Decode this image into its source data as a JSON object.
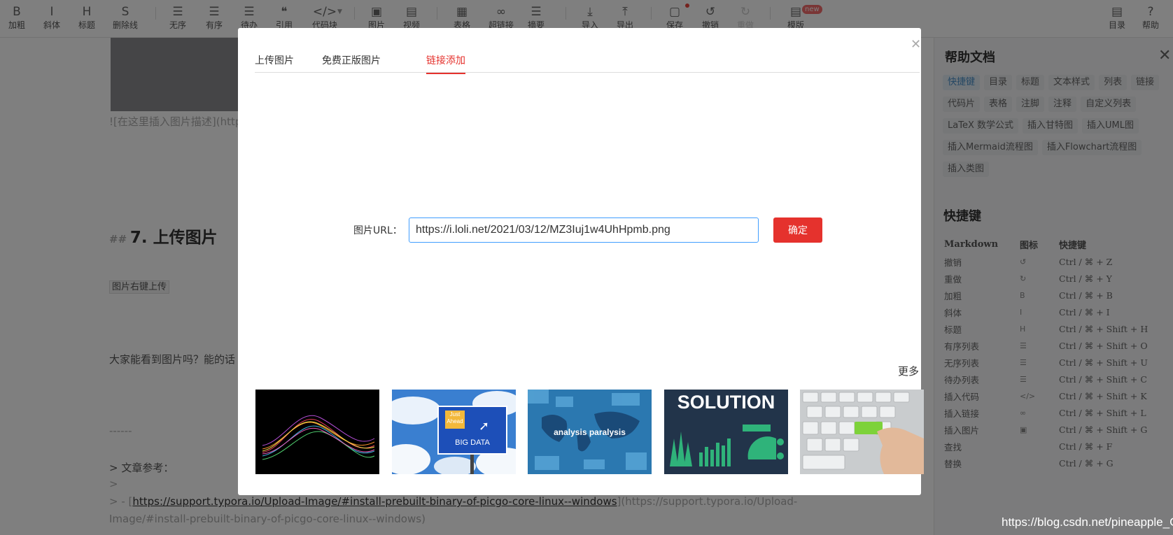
{
  "toolbar": {
    "items": [
      {
        "label": "加粗",
        "icon": "bold-icon",
        "glyph": "B"
      },
      {
        "label": "斜体",
        "icon": "italic-icon",
        "glyph": "I"
      },
      {
        "label": "标题",
        "icon": "heading-icon",
        "glyph": "H"
      },
      {
        "label": "删除线",
        "icon": "strikethrough-icon",
        "glyph": "S"
      },
      {
        "label": "无序",
        "icon": "unordered-list-icon",
        "glyph": "☰"
      },
      {
        "label": "有序",
        "icon": "ordered-list-icon",
        "glyph": "☰"
      },
      {
        "label": "待办",
        "icon": "todo-list-icon",
        "glyph": "☰"
      },
      {
        "label": "引用",
        "icon": "quote-icon",
        "glyph": "❝"
      },
      {
        "label": "代码块",
        "icon": "code-block-icon",
        "glyph": "</>"
      },
      {
        "label": "图片",
        "icon": "image-icon",
        "glyph": "▣"
      },
      {
        "label": "视频",
        "icon": "video-icon",
        "glyph": "▤"
      },
      {
        "label": "表格",
        "icon": "table-icon",
        "glyph": "▦"
      },
      {
        "label": "超链接",
        "icon": "link-icon",
        "glyph": "∞"
      },
      {
        "label": "摘要",
        "icon": "abstract-icon",
        "glyph": "☰"
      },
      {
        "label": "导入",
        "icon": "import-icon",
        "glyph": "⤓"
      },
      {
        "label": "导出",
        "icon": "export-icon",
        "glyph": "⤒"
      },
      {
        "label": "保存",
        "icon": "save-icon",
        "glyph": "▢"
      },
      {
        "label": "撤销",
        "icon": "undo-icon",
        "glyph": "↺"
      },
      {
        "label": "重做",
        "icon": "redo-icon",
        "glyph": "↻"
      },
      {
        "label": "模版",
        "icon": "template-icon",
        "glyph": "▤"
      },
      {
        "label": "目录",
        "icon": "toc-icon",
        "glyph": "▤"
      },
      {
        "label": "帮助",
        "icon": "help-icon",
        "glyph": "?"
      }
    ],
    "new_badge": "new"
  },
  "editor": {
    "img_markdown": "![在这里插入图片描述](http",
    "heading_hash": "##",
    "heading_text": "7. 上传图片",
    "inline_code": "图片右键上传",
    "para": "大家能看到图片吗？能的话",
    "hr": "------",
    "quote1": "> 文章参考：",
    "quote2": ">",
    "quote3_prefix": "> - [",
    "quote3_link": "https://support.typora.io/Upload-Image/#install-prebuilt-binary-of-picgo-core-linux--windows",
    "quote3_suffix": "](https://support.typora.io/Upload-",
    "quote4": "Image/#install-prebuilt-binary-of-picgo-core-linux--windows)"
  },
  "help": {
    "title": "帮助文档",
    "tags": [
      "快捷键",
      "目录",
      "标题",
      "文本样式",
      "列表",
      "链接",
      "代码片",
      "表格",
      "注脚",
      "注释",
      "自定义列表",
      "LaTeX 数学公式",
      "插入甘特图",
      "插入UML图",
      "插入Mermaid流程图",
      "插入Flowchart流程图",
      "插入类图"
    ],
    "shortcut_title": "快捷键",
    "columns": [
      "Markdown",
      "图标",
      "快捷键"
    ],
    "rows": [
      {
        "name": "撤销",
        "icon": "↺",
        "keys": "Ctrl / ⌘ + Z"
      },
      {
        "name": "重做",
        "icon": "↻",
        "keys": "Ctrl / ⌘ + Y"
      },
      {
        "name": "加粗",
        "icon": "B",
        "keys": "Ctrl / ⌘ + B"
      },
      {
        "name": "斜体",
        "icon": "I",
        "keys": "Ctrl / ⌘ + I"
      },
      {
        "name": "标题",
        "icon": "H",
        "keys": "Ctrl / ⌘ + Shift + H"
      },
      {
        "name": "有序列表",
        "icon": "☰",
        "keys": "Ctrl / ⌘ + Shift + O"
      },
      {
        "name": "无序列表",
        "icon": "☰",
        "keys": "Ctrl / ⌘ + Shift + U"
      },
      {
        "name": "待办列表",
        "icon": "☰",
        "keys": "Ctrl / ⌘ + Shift + C"
      },
      {
        "name": "插入代码",
        "icon": "</>",
        "keys": "Ctrl / ⌘ + Shift + K"
      },
      {
        "name": "插入链接",
        "icon": "∞",
        "keys": "Ctrl / ⌘ + Shift + L"
      },
      {
        "name": "插入图片",
        "icon": "▣",
        "keys": "Ctrl / ⌘ + Shift + G"
      },
      {
        "name": "查找",
        "icon": "",
        "keys": "Ctrl / ⌘ + F"
      },
      {
        "name": "替换",
        "icon": "",
        "keys": "Ctrl / ⌘ + G"
      }
    ]
  },
  "modal": {
    "tabs": [
      "上传图片",
      "免费正版图片",
      "链接添加"
    ],
    "active_tab": 2,
    "url_label": "图片URL：",
    "url_value": "https://i.loli.net/2021/03/12/MZ3Iuj1w4UhHpmb.png",
    "confirm": "确定",
    "more": "更多",
    "thumbs": [
      {
        "icon": "abstract-wave-image"
      },
      {
        "icon": "big-data-sign-image",
        "sign_top": "Just Ahead",
        "sign_bottom": "BIG DATA"
      },
      {
        "icon": "analysis-paralysis-image",
        "text": "analysis paralysis"
      },
      {
        "icon": "solution-chart-image",
        "text": "SOLUTION"
      },
      {
        "icon": "keyboard-hand-image"
      }
    ]
  },
  "colors": {
    "accent": "#e5322d",
    "input_border": "#409eff",
    "tag_active": "#4a90c8"
  },
  "watermark": "https://blog.csdn.net/pineapple_C"
}
